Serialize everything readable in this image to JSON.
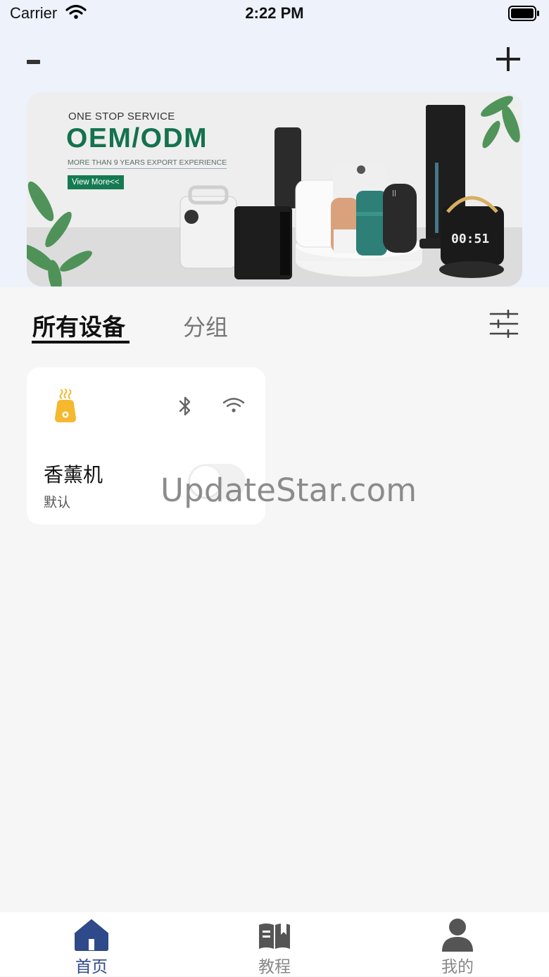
{
  "status_bar": {
    "carrier": "Carrier",
    "time": "2:22 PM"
  },
  "header": {
    "left_button_icon": "minus-icon",
    "right_button_icon": "plus-icon"
  },
  "banner": {
    "line1": "ONE STOP SERVICE",
    "line2": "OEM/ODM",
    "line3": "MORE THAN 9 YEARS EXPORT EXPERIENCE",
    "button": "View More<<"
  },
  "tabs": {
    "all_devices": "所有设备",
    "groups": "分组",
    "filter_icon": "sliders-icon"
  },
  "device_card": {
    "name": "香薰机",
    "group": "默认",
    "switch_on": false,
    "icons": [
      "diffuser-icon",
      "bluetooth-icon",
      "wifi-icon"
    ]
  },
  "watermark": "UpdateStar.com",
  "tabbar": {
    "items": [
      {
        "label": "首页",
        "icon": "home-icon",
        "active": true,
        "color": "#2f4a8a"
      },
      {
        "label": "教程",
        "icon": "book-icon",
        "active": false,
        "color": "#888888"
      },
      {
        "label": "我的",
        "icon": "person-icon",
        "active": false,
        "color": "#888888"
      }
    ]
  },
  "colors": {
    "accent": "#2f4a8a",
    "device_icon": "#f5b82e",
    "banner_green": "#157a52"
  }
}
